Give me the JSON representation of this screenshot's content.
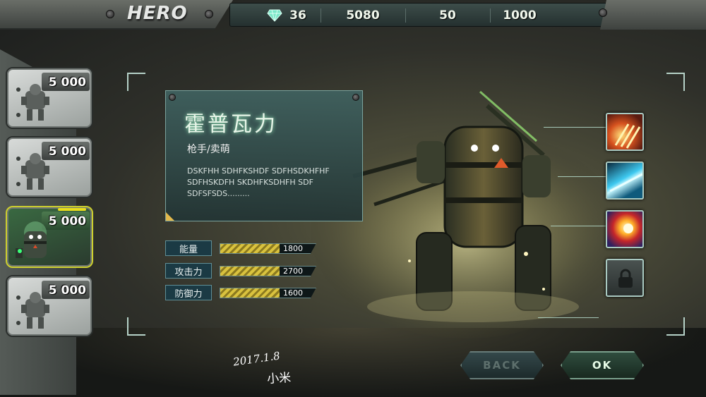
{
  "header": {
    "title": "HERO",
    "resources": [
      {
        "icon": "diamond-icon",
        "value": "36"
      },
      {
        "icon": "",
        "value": "5080"
      },
      {
        "icon": "",
        "value": "50"
      },
      {
        "icon": "",
        "value": "1000"
      }
    ]
  },
  "hero_list": [
    {
      "price": "5 000",
      "icon": "mech-silhouette-icon",
      "active": false
    },
    {
      "price": "5 000",
      "icon": "mech-silhouette-icon",
      "active": false
    },
    {
      "price": "5 000",
      "icon": "robot-portrait-icon",
      "active": true
    },
    {
      "price": "5 000",
      "icon": "mech-silhouette-icon",
      "active": false
    }
  ],
  "hero": {
    "name": "霍普瓦力",
    "role": "枪手/卖萌",
    "description": "DSKFHH SDHFKSHDF SDFHSDKHFHF SDFHSKDFH  SKDHFKSDHFH SDF SDFSFSDS........."
  },
  "stats": [
    {
      "label": "能量",
      "value": "1800",
      "fill": 0.62
    },
    {
      "label": "攻击力",
      "value": "2700",
      "fill": 0.62
    },
    {
      "label": "防御力",
      "value": "1600",
      "fill": 0.62
    }
  ],
  "skills": [
    {
      "icon": "fire-claw-icon",
      "locked": false
    },
    {
      "icon": "ice-slash-icon",
      "locked": false
    },
    {
      "icon": "fireball-icon",
      "locked": false
    },
    {
      "icon": "lock-icon",
      "locked": true
    }
  ],
  "buttons": {
    "back": "BACK",
    "ok": "OK"
  },
  "signature": {
    "date": "2017.1.8",
    "name": "小米"
  },
  "colors": {
    "accent": "#e9de1a",
    "frame": "#b6d2c8",
    "panel": "#2e4a49"
  }
}
